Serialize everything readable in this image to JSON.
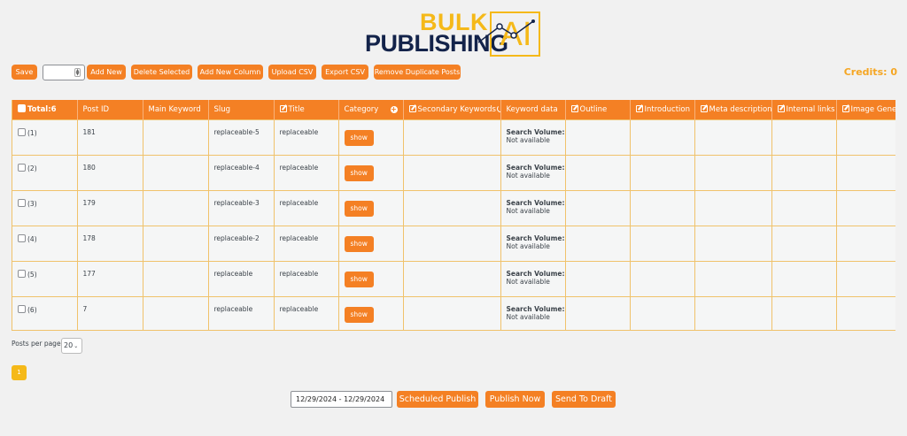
{
  "logo": {
    "word1": "BULK",
    "word2": "PUBLISHING",
    "word3": "AI"
  },
  "toolbar": {
    "save": "Save",
    "add_new": "Add New",
    "delete_selected": "Delete Selected",
    "add_new_column": "Add New Column",
    "upload_csv": "Upload CSV",
    "export_csv": "Export CSV",
    "remove_duplicates": "Remove Duplicate Posts"
  },
  "credits": "Credits: 0",
  "table": {
    "headers": {
      "total": "Total:6",
      "post_id": "Post ID",
      "main_keyword": "Main Keyword",
      "slug": "Slug",
      "title": "Title",
      "category": "Category",
      "secondary_keywords": "Secondary Keywords",
      "keyword_data": "Keyword data",
      "outline": "Outline",
      "introduction": "Introduction",
      "meta_description": "Meta description",
      "internal_links": "Internal links",
      "image_generation": "Image Generation"
    },
    "show_label": "show",
    "sv_label": "Search Volume:",
    "sv_value": "Not available",
    "rows": [
      {
        "idx": "(1)",
        "post_id": "181",
        "slug": "replaceable-5",
        "title": "replaceable"
      },
      {
        "idx": "(2)",
        "post_id": "180",
        "slug": "replaceable-4",
        "title": "replaceable"
      },
      {
        "idx": "(3)",
        "post_id": "179",
        "slug": "replaceable-3",
        "title": "replaceable"
      },
      {
        "idx": "(4)",
        "post_id": "178",
        "slug": "replaceable-2",
        "title": "replaceable"
      },
      {
        "idx": "(5)",
        "post_id": "177",
        "slug": "replaceable",
        "title": "replaceable"
      },
      {
        "idx": "(6)",
        "post_id": "7",
        "slug": "replaceable",
        "title": "replaceable"
      }
    ]
  },
  "pagination": {
    "per_page_label": "Posts per page:",
    "per_page_value": "20",
    "current_page": "1"
  },
  "footer": {
    "date_range": "12/29/2024 - 12/29/2024",
    "scheduled_publish": "Scheduled Publish",
    "publish_now": "Publish Now",
    "send_to_draft": "Send To Draft"
  },
  "colors": {
    "accent": "#f48024",
    "brand_yellow": "#f5b919",
    "brand_navy": "#13234a",
    "credits": "#f5a623"
  }
}
